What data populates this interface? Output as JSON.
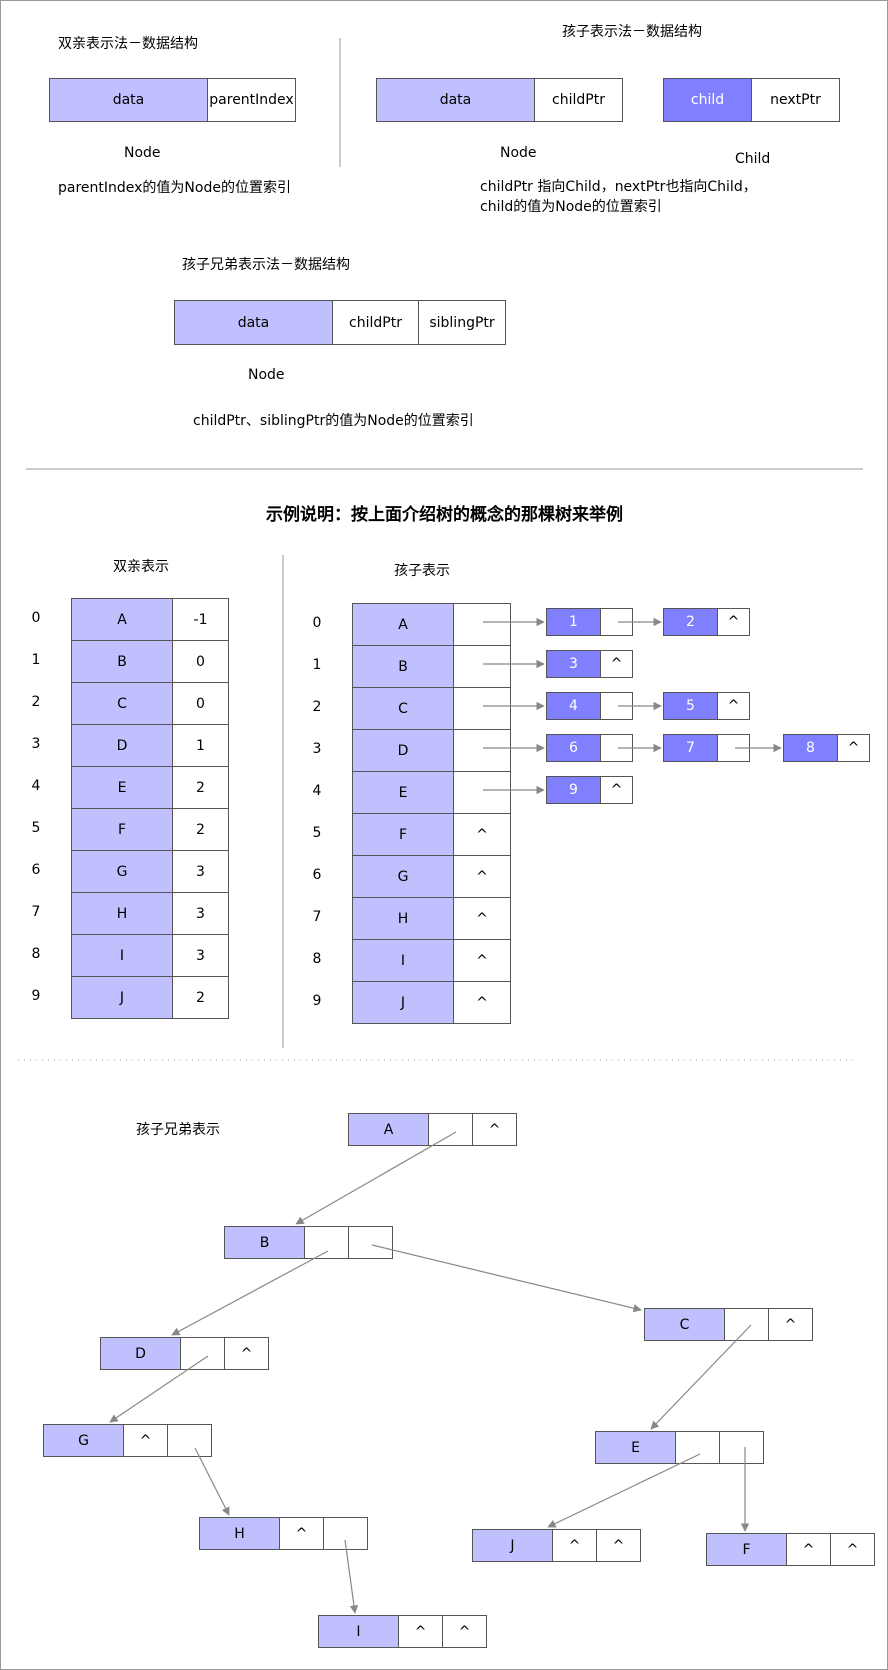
{
  "top": {
    "parent_title": "双亲表示法－数据结构",
    "parent_node": {
      "data": "data",
      "ptr": "parentIndex",
      "caption": "Node",
      "note": "parentIndex的值为Node的位置索引"
    },
    "child_title": "孩子表示法－数据结构",
    "child_node": {
      "data": "data",
      "ptr": "childPtr",
      "caption": "Node"
    },
    "child_struct": {
      "child": "child",
      "next": "nextPtr",
      "caption": "Child"
    },
    "child_note1": "childPtr  指向Child，nextPtr也指向Child，",
    "child_note2": "child的值为Node的位置索引",
    "sibling_title": "孩子兄弟表示法－数据结构",
    "sibling_node": {
      "data": "data",
      "child": "childPtr",
      "sibling": "siblingPtr",
      "caption": "Node"
    },
    "sibling_note": "childPtr、siblingPtr的值为Node的位置索引"
  },
  "example_title": "示例说明：按上面介绍树的概念的那棵树来举例",
  "parent_table": {
    "title": "双亲表示",
    "indices": [
      "0",
      "1",
      "2",
      "3",
      "4",
      "5",
      "6",
      "7",
      "8",
      "9"
    ],
    "data": [
      "A",
      "B",
      "C",
      "D",
      "E",
      "F",
      "G",
      "H",
      "I",
      "J"
    ],
    "parent": [
      "-1",
      "0",
      "0",
      "1",
      "2",
      "2",
      "3",
      "3",
      "3",
      "2"
    ]
  },
  "child_table": {
    "title": "孩子表示",
    "indices": [
      "0",
      "1",
      "2",
      "3",
      "4",
      "5",
      "6",
      "7",
      "8",
      "9"
    ],
    "data": [
      "A",
      "B",
      "C",
      "D",
      "E",
      "F",
      "G",
      "H",
      "I",
      "J"
    ],
    "ptr": [
      "",
      "",
      "",
      "",
      "",
      "^",
      "^",
      "^",
      "^",
      "^"
    ],
    "chains": [
      [
        {
          "v": "1",
          "n": ""
        },
        {
          "v": "2",
          "n": "^"
        }
      ],
      [
        {
          "v": "3",
          "n": "^"
        }
      ],
      [
        {
          "v": "4",
          "n": ""
        },
        {
          "v": "5",
          "n": "^"
        }
      ],
      [
        {
          "v": "6",
          "n": ""
        },
        {
          "v": "7",
          "n": ""
        },
        {
          "v": "8",
          "n": "^"
        }
      ],
      [
        {
          "v": "9",
          "n": "^"
        }
      ]
    ]
  },
  "sibling_tree": {
    "title": "孩子兄弟表示",
    "nodes": [
      {
        "id": "A",
        "c": "",
        "s": "^"
      },
      {
        "id": "B",
        "c": "",
        "s": ""
      },
      {
        "id": "C",
        "c": "",
        "s": "^"
      },
      {
        "id": "D",
        "c": "",
        "s": "^"
      },
      {
        "id": "E",
        "c": "",
        "s": ""
      },
      {
        "id": "G",
        "c": "^",
        "s": ""
      },
      {
        "id": "H",
        "c": "^",
        "s": ""
      },
      {
        "id": "J",
        "c": "^",
        "s": "^"
      },
      {
        "id": "F",
        "c": "^",
        "s": "^"
      },
      {
        "id": "I",
        "c": "^",
        "s": "^"
      }
    ]
  },
  "colors": {
    "lavender": "#c0c0ff",
    "blue": "#8080ff",
    "arrow": "#888888"
  }
}
